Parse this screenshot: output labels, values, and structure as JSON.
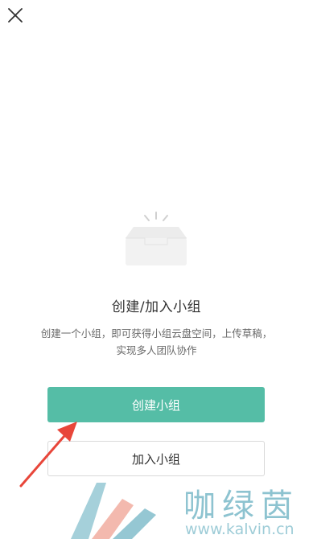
{
  "header": {
    "close_icon": "close-icon"
  },
  "empty_state": {
    "illustration_icon": "empty-tray-icon",
    "title": "创建/加入小组",
    "description_lines": [
      "创建一个小组，即可获得小组云盘空间，上传草稿，",
      "实现多人团队协作"
    ]
  },
  "actions": {
    "create_label": "创建小组",
    "join_label": "加入小组"
  },
  "annotation": {
    "arrow_icon": "arrow-annotation-icon",
    "color": "#e8463a"
  },
  "watermark": {
    "name": "咖绿茵",
    "url": "www.kalvin.cn",
    "logo_icon": "kalvin-logo-icon"
  },
  "colors": {
    "accent": "#55bda6",
    "title_text": "#333333",
    "secondary_text": "#6a6a6a",
    "border": "#d9d9d9"
  }
}
